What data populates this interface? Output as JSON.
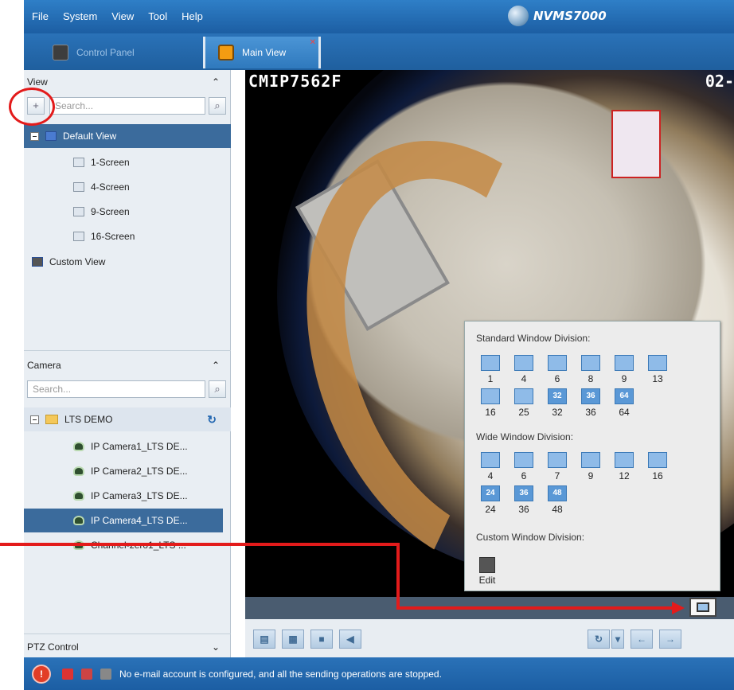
{
  "menu": [
    "File",
    "System",
    "View",
    "Tool",
    "Help"
  ],
  "brand": "NVMS7000",
  "tabs": [
    {
      "label": "Control Panel"
    },
    {
      "label": "Main View"
    }
  ],
  "view_panel": {
    "title": "View",
    "search_placeholder": "Search...",
    "items": [
      {
        "label": "Default View"
      },
      {
        "label": "1-Screen"
      },
      {
        "label": "4-Screen"
      },
      {
        "label": "9-Screen"
      },
      {
        "label": "16-Screen"
      },
      {
        "label": "Custom View"
      }
    ]
  },
  "camera_panel": {
    "title": "Camera",
    "search_placeholder": "Search...",
    "group": "LTS DEMO",
    "items": [
      {
        "label": "IP Camera1_LTS DE..."
      },
      {
        "label": "IP Camera2_LTS DE..."
      },
      {
        "label": "IP Camera3_LTS DE..."
      },
      {
        "label": "IP Camera4_LTS DE..."
      },
      {
        "label": "Channel-zero1_LTS ..."
      }
    ]
  },
  "ptz": {
    "title": "PTZ Control"
  },
  "video": {
    "osd_left": "CMIP7562F",
    "osd_right": "02-"
  },
  "window_division": {
    "standard_title": "Standard Window Division:",
    "standard": [
      "1",
      "4",
      "6",
      "8",
      "9",
      "13",
      "16",
      "25",
      "32",
      "36",
      "64"
    ],
    "wide_title": "Wide Window Division:",
    "wide": [
      "4",
      "6",
      "7",
      "9",
      "12",
      "16",
      "24",
      "36",
      "48"
    ],
    "custom_title": "Custom Window Division:",
    "edit_label": "Edit"
  },
  "status": {
    "message": "No e-mail account is configured, and all the sending operations are stopped."
  },
  "colors": {
    "header_blue": "#1f5f9e",
    "selected_row": "#3b6b9c",
    "annotation_red": "#e31b1b"
  }
}
